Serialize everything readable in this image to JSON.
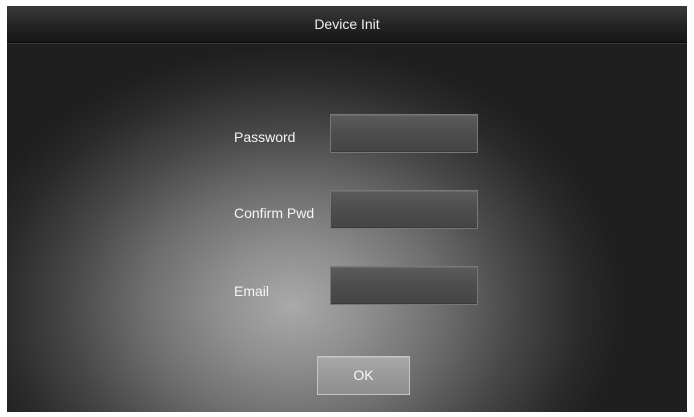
{
  "window": {
    "title": "Device Init"
  },
  "form": {
    "password": {
      "label": "Password",
      "value": ""
    },
    "confirm_pwd": {
      "label": "Confirm Pwd",
      "value": ""
    },
    "email": {
      "label": "Email",
      "value": ""
    },
    "ok_label": "OK"
  }
}
